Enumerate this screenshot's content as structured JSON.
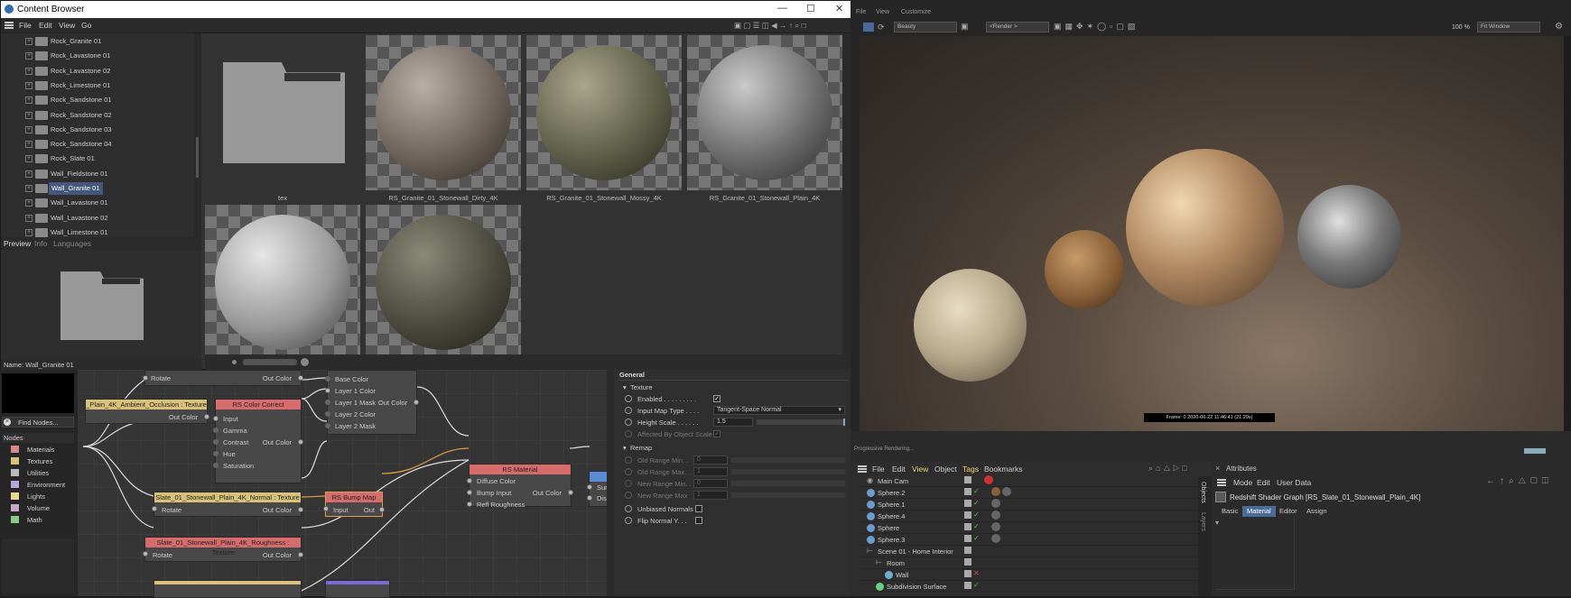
{
  "content_browser": {
    "title": "Content Browser",
    "menu": [
      "File",
      "Edit",
      "View",
      "Go"
    ],
    "tree": [
      "Rock_Granite 01",
      "Rock_Lavastone 01",
      "Rock_Lavastone 02",
      "Rock_Limestone 01",
      "Rock_Sandstone 01",
      "Rock_Sandstone 02",
      "Rock_Sandstone 03",
      "Rock_Sandstone 04",
      "Rock_Slate 01",
      "Wall_Fieldstone 01",
      "Wall_Granite 01",
      "Wall_Lavastone 01",
      "Wall_Lavastone 02",
      "Wall_Limestone 01"
    ],
    "selected_item": "Wall_Granite 01",
    "items": [
      {
        "caption": "tex"
      },
      {
        "caption": "RS_Granite_01_Stonewall_Dirty_4K"
      },
      {
        "caption": "RS_Granite_01_Stonewall_Mossy_4K"
      },
      {
        "caption": "RS_Granite_01_Stonewall_Plain_4K"
      },
      {
        "caption": ""
      },
      {
        "caption": ""
      }
    ],
    "preview_tabs": [
      "Preview",
      "Info",
      "Languages"
    ],
    "name_label": "Name: Wall_Granite 01"
  },
  "node_editor": {
    "find_nodes": "Find Nodes...",
    "nodes_header": "Nodes",
    "categories": [
      "Materials",
      "Textures",
      "Utilities",
      "Environment",
      "Lights",
      "Volume",
      "Math"
    ],
    "nodes": {
      "ao_tex": {
        "title": "_Plain_4K_Ambient_Occlusion : Texture",
        "out": "Out Color"
      },
      "rotate_top": {
        "row": "Rotate",
        "out": "Out Color"
      },
      "color_correct": {
        "title": "RS Color Correct",
        "rows": [
          "Input",
          "Gamma",
          "Contrast",
          "Hue",
          "Saturation"
        ],
        "out": "Out Color"
      },
      "layer": {
        "rows": [
          "Base Color",
          "Layer 1 Color",
          "Layer 1 Mask",
          "Layer 2 Color",
          "Layer 2 Mask"
        ],
        "out": "Out Color"
      },
      "normal_tex": {
        "title": "Slate_01_Stonewall_Plain_4K_Normal : Texture",
        "row": "Rotate",
        "out": "Out Color"
      },
      "bump": {
        "title": "RS Bump Map",
        "in": "Input",
        "out": "Out"
      },
      "rough_tex": {
        "title": "Slate_01_Stonewall_Plain_4K_Roughness : Texture",
        "row": "Rotate",
        "out": "Out Color"
      },
      "material": {
        "title": "RS Material",
        "rows": [
          "Diffuse Color",
          "Bump Input",
          "Refl Roughness"
        ],
        "out": "Out Color"
      },
      "output": {
        "rows": [
          "Sur",
          "Dis"
        ]
      }
    }
  },
  "shader_attrs": {
    "general": "General",
    "texture": "Texture",
    "enabled": "Enabled . . . . . . . . .",
    "input_map_type": "Input Map Type . . . .",
    "input_map_value": "Tangent-Space Normal",
    "height_scale": "Height Scale . . . . . .",
    "height_value": "1.5",
    "affected": "Affected By Object Scale",
    "remap": "Remap",
    "old_min": "Old Range Min. .",
    "old_max": "Old Range Max. .",
    "new_min": "New Range Min. .",
    "new_max": "New Range Max",
    "zero": "0",
    "one": "1",
    "unbiased": "Unbiased Normals",
    "flip": "Flip Normal Y. . ."
  },
  "viewport": {
    "menu": [
      "File",
      "View",
      "Customize"
    ],
    "camera": "Beauty",
    "render_sel": "<Render >",
    "zoom": "100 %",
    "fit": "Fit Window",
    "frame_info": "Frame: 0   2020-06-22  11:46:41  (21.29s)",
    "status": "Progressive Rendering..."
  },
  "object_manager": {
    "menu": [
      "File",
      "Edit",
      "View",
      "Object",
      "Tags",
      "Bookmarks"
    ],
    "rows": [
      "Main Cam",
      "Sphere.2",
      "Sphere.1",
      "Sphere.4",
      "Sphere",
      "Sphere.3",
      "Scene 01 - Home Interior",
      "Room",
      "Wall",
      "Subdivision Surface"
    ],
    "side_tabs": [
      "Objects",
      "Layers"
    ]
  },
  "attributes": {
    "title": "Attributes",
    "menu": [
      "Mode",
      "Edit",
      "User Data"
    ],
    "object": "Redshift Shader Graph [RS_Slate_01_Stonewall_Plain_4K]",
    "tabs": [
      "Basic",
      "Material",
      "Editor",
      "Assign"
    ],
    "active_tab": "Material"
  }
}
